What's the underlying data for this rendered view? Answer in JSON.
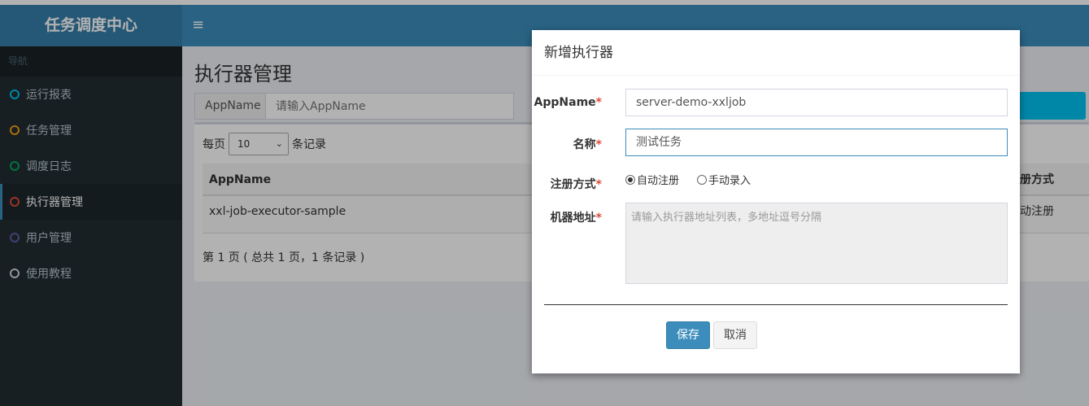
{
  "header": {
    "logo": "任务调度中心",
    "menu_icon": "≡"
  },
  "sidebar": {
    "nav_header": "导航",
    "items": [
      {
        "label": "运行报表",
        "color": "#00c0ef",
        "active": false
      },
      {
        "label": "任务管理",
        "color": "#f39c12",
        "active": false
      },
      {
        "label": "调度日志",
        "color": "#00a65a",
        "active": false
      },
      {
        "label": "执行器管理",
        "color": "#dd4b39",
        "active": true
      },
      {
        "label": "用户管理",
        "color": "#605ca8",
        "active": false
      },
      {
        "label": "使用教程",
        "color": "#d2d6de",
        "active": false
      }
    ]
  },
  "main": {
    "title": "执行器管理",
    "filter": {
      "label": "AppName",
      "placeholder": "请输入AppName"
    },
    "length": {
      "prefix": "每页",
      "value": "10",
      "suffix": "条记录"
    },
    "table": {
      "columns": [
        "AppName",
        "册方式"
      ],
      "rows": [
        {
          "appname": "xxl-job-executor-sample",
          "reg": "动注册"
        }
      ]
    },
    "page_info": "第 1 页 ( 总共 1 页，1 条记录 )"
  },
  "modal": {
    "title": "新增执行器",
    "appname": {
      "label": "AppName",
      "req": "*",
      "value": "server-demo-xxljob"
    },
    "name": {
      "label": "名称",
      "req": "*",
      "value": "测试任务"
    },
    "regtype": {
      "label": "注册方式",
      "req": "*",
      "options": [
        "自动注册",
        "手动录入"
      ],
      "selected": 0
    },
    "address": {
      "label": "机器地址",
      "req": "*",
      "placeholder": "请输入执行器地址列表，多地址逗号分隔"
    },
    "save": "保存",
    "cancel": "取消"
  }
}
